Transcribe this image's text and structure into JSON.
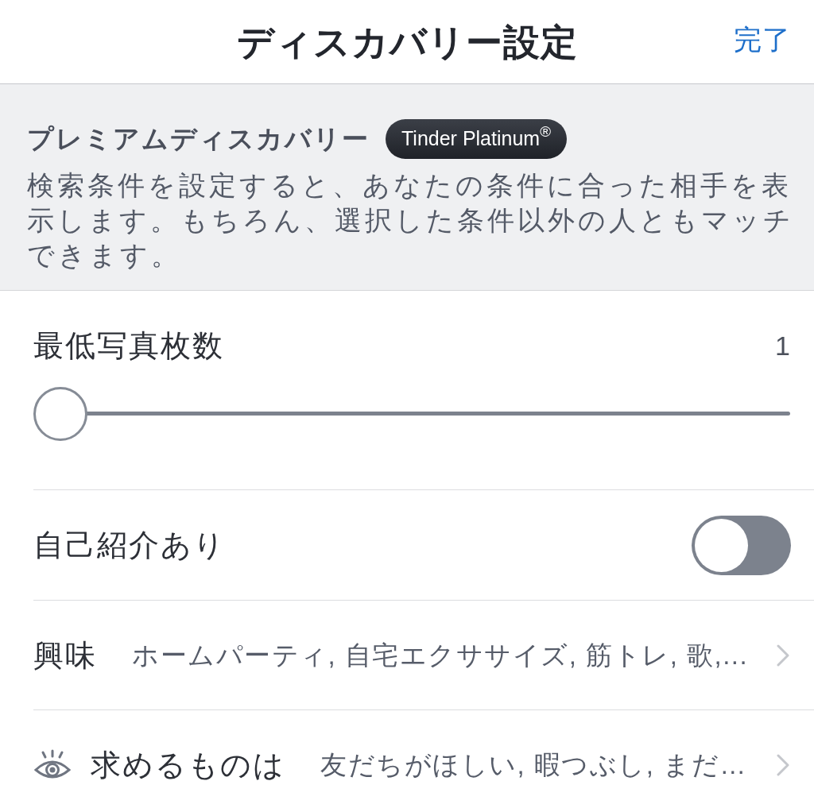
{
  "header": {
    "title": "ディスカバリー設定",
    "done_button": "完了"
  },
  "premium": {
    "title": "プレミアムディスカバリー",
    "badge": "Tinder Platinum$^{®}$",
    "description": "検索条件を設定すると、あなたの条件に合った相手を表示します。もちろん、選択した条件以外の人ともマッチできます。"
  },
  "settings": [
    {
      "kind": "slider",
      "label": "最低写真枚数",
      "value": "1",
      "level": 0
    },
    {
      "kind": "toggle",
      "label": "自己紹介あり",
      "on": false
    },
    {
      "kind": "link",
      "label": "興味",
      "value": "ホームパーティ, 自宅エクササイズ, 筋トレ, 歌,...",
      "icon": false
    },
    {
      "kind": "link",
      "label": "求めるものは",
      "value": "友だちがほしい, 暇つぶし, まだ…",
      "icon": true
    }
  ]
}
